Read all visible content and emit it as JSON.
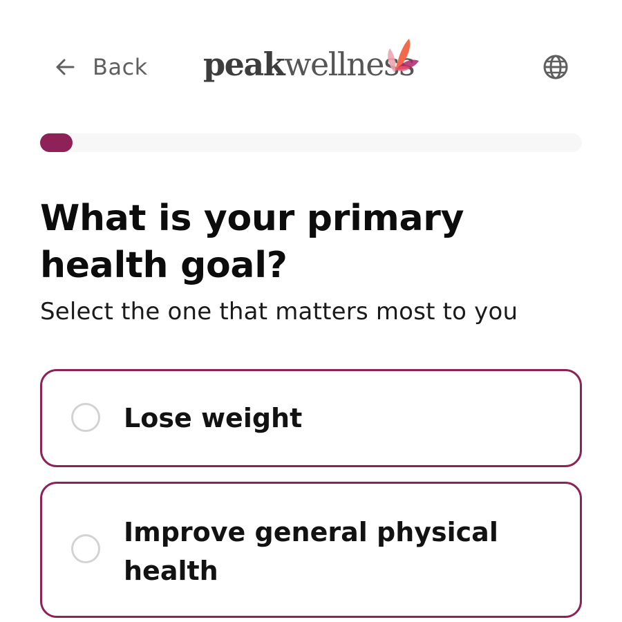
{
  "header": {
    "back_label": "Back",
    "logo": {
      "text_bold": "peak",
      "text_light": "wellness",
      "brand_colors": {
        "wing_pink": "#f0a3b2",
        "wing_orange": "#f26a4b",
        "wing_magenta": "#b0246a"
      }
    },
    "icons": {
      "back": "arrow-left-icon",
      "language": "globe-icon"
    }
  },
  "progress": {
    "value": 0.06,
    "fill_color": "#8e2157",
    "track_color": "#f7f7f7"
  },
  "question": {
    "title": "What is your primary health goal?",
    "subtitle": "Select the one that matters most to you"
  },
  "options": [
    {
      "label": "Lose weight",
      "selected": false
    },
    {
      "label": "Improve general physical health",
      "selected": false
    }
  ],
  "colors": {
    "accent": "#8e2157",
    "radio_border": "#d3d3d3",
    "text": "#111111",
    "muted_text": "#5f5f5f"
  }
}
